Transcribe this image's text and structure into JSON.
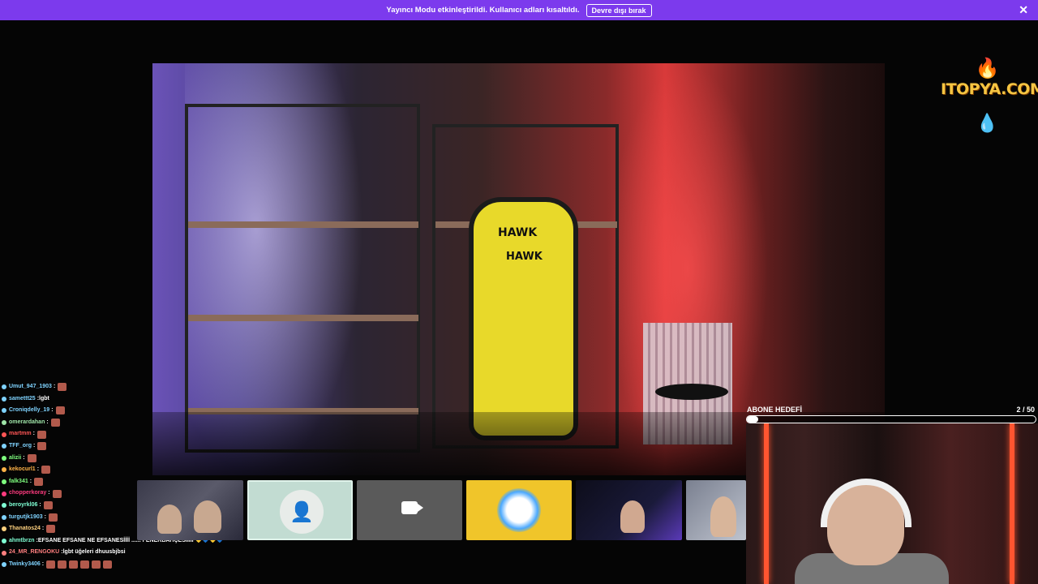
{
  "banner": {
    "message": "Yayıncı Modu etkinleştirildi. Kullanıcı adları kısaltıldı.",
    "button_label": "Devre dışı bırak",
    "close_icon": "close-icon",
    "background_color": "#7c3aed"
  },
  "side_logo": {
    "brand_name": "ITOPYA.COM",
    "top_icon": "flame-icon",
    "bottom_icon": "droplet-icon"
  },
  "chat": {
    "messages": [
      {
        "user": "Umut_947_1903",
        "text": "",
        "emotes": 1,
        "color": "#7fd3ff"
      },
      {
        "user": "samettt25",
        "text": "lgbt",
        "emotes": 0,
        "color": "#7fd3ff"
      },
      {
        "user": "Croniqdelly_19",
        "text": "",
        "emotes": 1,
        "color": "#7fd3ff"
      },
      {
        "user": "omerardahan",
        "text": "",
        "emotes": 1,
        "color": "#9fe5a8"
      },
      {
        "user": "martmm",
        "text": "",
        "emotes": 1,
        "color": "#ff5555"
      },
      {
        "user": "TFF_org",
        "text": "",
        "emotes": 1,
        "color": "#7fd3ff"
      },
      {
        "user": "alizii",
        "text": "",
        "emotes": 1,
        "color": "#7fff7f"
      },
      {
        "user": "kekocurl1",
        "text": "",
        "emotes": 1,
        "color": "#ffb347"
      },
      {
        "user": "falk341",
        "text": "",
        "emotes": 1,
        "color": "#7fff7f"
      },
      {
        "user": "chopperkoray",
        "text": "",
        "emotes": 1,
        "color": "#ff3b7f"
      },
      {
        "user": "beroyrkl06",
        "text": "",
        "emotes": 1,
        "color": "#7fffd4"
      },
      {
        "user": "turgutjk1903",
        "text": "",
        "emotes": 1,
        "color": "#7fd3ff"
      },
      {
        "user": "Thanatos24",
        "text": "",
        "emotes": 1,
        "color": "#ffd27f"
      },
      {
        "user": "ahmtbrzn",
        "text": "EFSANE EFSANE NE EFSANESİİİİ ...... FENERBAHÇESİİİİİ 💛💙💛💙",
        "emotes": 0,
        "color": "#7fffd4"
      },
      {
        "user": "24_MR_RENGOKU",
        "text": "lgbt üğeleri dhuusbjbsi",
        "emotes": 0,
        "color": "#ff7f7f"
      },
      {
        "user": "Twinky3406",
        "text": "",
        "emotes": 6,
        "color": "#7fd3ff"
      }
    ]
  },
  "strip": {
    "thumbnails": [
      {
        "name": "participant-1"
      },
      {
        "name": "participant-2-active"
      },
      {
        "name": "participant-3-camera-off"
      },
      {
        "name": "participant-4"
      },
      {
        "name": "participant-5"
      },
      {
        "name": "participant-6"
      }
    ],
    "camera_icon": "video-camera-icon"
  },
  "subscriber_goal": {
    "title": "ABONE HEDEFİ",
    "current": 2,
    "target": 50,
    "count_text": "2 / 50",
    "progress_fraction": 0.04
  },
  "scene": {
    "chair_brand": "HAWK",
    "chair_sub": "HAWK"
  }
}
